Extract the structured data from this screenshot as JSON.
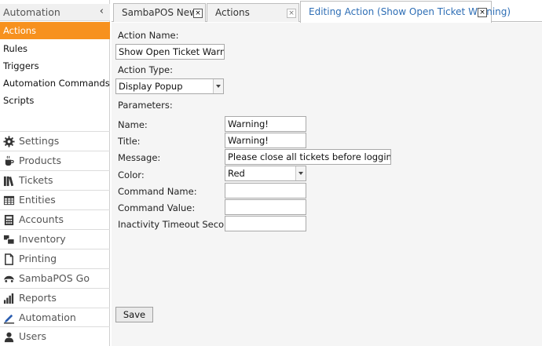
{
  "sidebar": {
    "header": "Automation",
    "collapse_glyph": "‹",
    "sub_items": [
      {
        "label": "Actions",
        "active": true
      },
      {
        "label": "Rules",
        "active": false
      },
      {
        "label": "Triggers",
        "active": false
      },
      {
        "label": "Automation Commands",
        "active": false
      },
      {
        "label": "Scripts",
        "active": false
      }
    ],
    "menu": [
      {
        "label": "Settings",
        "icon": "gear-icon"
      },
      {
        "label": "Products",
        "icon": "coffee-cup-icon"
      },
      {
        "label": "Tickets",
        "icon": "books-icon"
      },
      {
        "label": "Entities",
        "icon": "table-icon"
      },
      {
        "label": "Accounts",
        "icon": "calculator-icon"
      },
      {
        "label": "Inventory",
        "icon": "boxes-icon"
      },
      {
        "label": "Printing",
        "icon": "document-icon"
      },
      {
        "label": "SambaPOS Go",
        "icon": "go-icon"
      },
      {
        "label": "Reports",
        "icon": "bar-chart-icon"
      },
      {
        "label": "Automation",
        "icon": "pencil-icon"
      },
      {
        "label": "Users",
        "icon": "user-icon"
      }
    ]
  },
  "tabs": [
    {
      "label": "SambaPOS News",
      "close": "×"
    },
    {
      "label": "Actions",
      "close": "×"
    },
    {
      "label": "Editing Action (Show Open Ticket Warning)",
      "close": "×"
    }
  ],
  "form": {
    "action_name_label": "Action Name:",
    "action_name_value": "Show Open Ticket Warning",
    "action_type_label": "Action Type:",
    "action_type_value": "Display Popup",
    "parameters_label": "Parameters:",
    "params": [
      {
        "label": "Name:",
        "value": "Warning!"
      },
      {
        "label": "Title:",
        "value": "Warning!"
      },
      {
        "label": "Message:",
        "value": "Please close all tickets before logging out."
      },
      {
        "label": "Color:",
        "value": "Red"
      },
      {
        "label": "Command Name:",
        "value": ""
      },
      {
        "label": "Command Value:",
        "value": ""
      },
      {
        "label": "Inactivity Timeout Seconds:",
        "value": ""
      }
    ],
    "save_label": "Save"
  }
}
